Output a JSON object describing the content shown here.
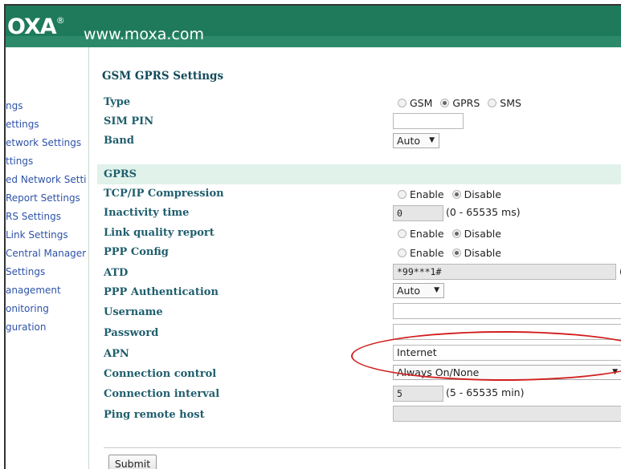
{
  "header": {
    "logo_text": "OXA",
    "logo_mark": "®",
    "url": "www.moxa.com"
  },
  "nav": {
    "items": [
      {
        "label": "ngs"
      },
      {
        "label": "ettings"
      },
      {
        "label": "etwork Settings"
      },
      {
        "label": "ttings"
      },
      {
        "label": "ed Network Setti"
      },
      {
        "label": " Report Settings"
      },
      {
        "label": "RS Settings"
      },
      {
        "label": "Link Settings"
      },
      {
        "label": "Central Manager"
      },
      {
        "label": " Settings"
      },
      {
        "label": "anagement"
      },
      {
        "label": "onitoring"
      },
      {
        "label": "guration"
      }
    ]
  },
  "page": {
    "title": "GSM GPRS Settings"
  },
  "gsm": {
    "type_label": "Type",
    "type_options": [
      {
        "label": "GSM",
        "selected": false
      },
      {
        "label": "GPRS",
        "selected": true
      },
      {
        "label": "SMS",
        "selected": false
      }
    ],
    "sim_pin_label": "SIM PIN",
    "sim_pin_value": "",
    "band_label": "Band",
    "band_value": "Auto"
  },
  "gprs": {
    "section_label": "GPRS",
    "tcp_label": "TCP/IP Compression",
    "tcp_enable": "Enable",
    "tcp_disable": "Disable",
    "inactivity_label": "Inactivity time",
    "inactivity_value": "0",
    "inactivity_hint": "(0 - 65535 ms)",
    "linkq_label": "Link quality report",
    "linkq_enable": "Enable",
    "linkq_disable": "Disable",
    "ppp_label": "PPP Config",
    "ppp_enable": "Enable",
    "ppp_disable": "Disable",
    "atd_label": "ATD",
    "atd_value": "*99***1#",
    "atd_trail": "(",
    "auth_label": "PPP Authentication",
    "auth_value": "Auto",
    "username_label": "Username",
    "username_value": "",
    "password_label": "Password",
    "password_value": "",
    "apn_label": "APN",
    "apn_value": "Internet",
    "conn_ctrl_label": "Connection control",
    "conn_ctrl_value": "Always On/None",
    "conn_int_label": "Connection interval",
    "conn_int_value": "5",
    "conn_int_hint": "(5 - 65535 min)",
    "ping_label": "Ping remote host",
    "ping_value": ""
  },
  "actions": {
    "submit_label": "Submit"
  },
  "colors": {
    "header_green": "#1f7a5c",
    "label_teal": "#1f5e6d",
    "nav_link": "#2e53a8",
    "annotation_red": "#d11f1f"
  }
}
